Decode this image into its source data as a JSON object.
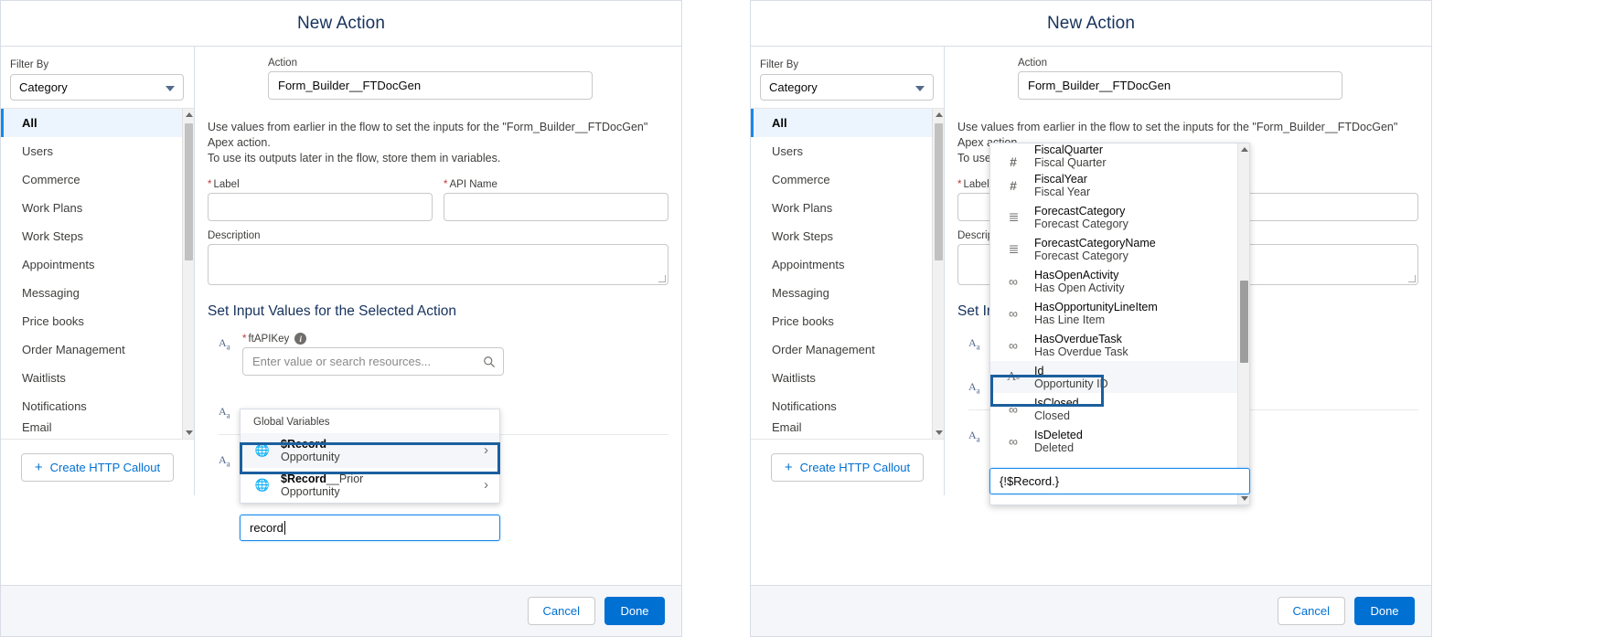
{
  "modal": {
    "title": "New Action"
  },
  "sidebar": {
    "filter_label": "Filter By",
    "filter_value": "Category",
    "items": [
      {
        "label": "All",
        "selected": true
      },
      {
        "label": "Users",
        "selected": false
      },
      {
        "label": "Commerce",
        "selected": false
      },
      {
        "label": "Work Plans",
        "selected": false
      },
      {
        "label": "Work Steps",
        "selected": false
      },
      {
        "label": "Appointments",
        "selected": false
      },
      {
        "label": "Messaging",
        "selected": false
      },
      {
        "label": "Price books",
        "selected": false
      },
      {
        "label": "Order Management",
        "selected": false
      },
      {
        "label": "Waitlists",
        "selected": false
      },
      {
        "label": "Notifications",
        "selected": false
      },
      {
        "label": "Email",
        "selected": false
      }
    ],
    "callout_button": "Create HTTP Callout",
    "plus_icon": "+"
  },
  "content": {
    "action_label": "Action",
    "action_value": "Form_Builder__FTDocGen",
    "helper_line1": "Use values from earlier in the flow to set the inputs for the \"Form_Builder__FTDocGen\" Apex action.",
    "helper_line2": "To use its outputs later in the flow, store them in variables.",
    "label_label": "Label",
    "label_value": "",
    "api_name_label": "API Name",
    "api_name_value": "",
    "description_label": "Description",
    "description_value": "",
    "section_title": "Set Input Values for the Selected Action",
    "ftapikey_label": "ftAPIKey",
    "ftapikey_info": "i",
    "ftapikey_placeholder": "Enter value or search resources...",
    "required_marker": "*",
    "text_type_icon": "Aa"
  },
  "left_popup": {
    "group_label": "Global Variables",
    "options": [
      {
        "name": "$Record",
        "sub": "Opportunity",
        "icon": "globe-icon",
        "chevron": "›",
        "highlighted": true
      },
      {
        "name": "$Record__Prior",
        "name_bold": "$Record",
        "name_rest": "__Prior",
        "sub": "Opportunity",
        "icon": "globe-icon",
        "chevron": "›",
        "highlighted": false
      }
    ],
    "typed_value": "record"
  },
  "right_popup": {
    "options": [
      {
        "api": "FiscalQuarter",
        "label": "Fiscal Quarter",
        "icon": "number-icon",
        "glyph": "#",
        "highlighted": false
      },
      {
        "api": "FiscalYear",
        "label": "Fiscal Year",
        "icon": "number-icon",
        "glyph": "#",
        "highlighted": false
      },
      {
        "api": "ForecastCategory",
        "label": "Forecast Category",
        "icon": "picklist-icon",
        "glyph": "☰",
        "highlighted": false
      },
      {
        "api": "ForecastCategoryName",
        "label": "Forecast Category",
        "icon": "picklist-icon",
        "glyph": "☰",
        "highlighted": false
      },
      {
        "api": "HasOpenActivity",
        "label": "Has Open Activity",
        "icon": "boolean-icon",
        "glyph": "∞",
        "highlighted": false
      },
      {
        "api": "HasOpportunityLineItem",
        "label": "Has Line Item",
        "icon": "boolean-icon",
        "glyph": "∞",
        "highlighted": false
      },
      {
        "api": "HasOverdueTask",
        "label": "Has Overdue Task",
        "icon": "boolean-icon",
        "glyph": "∞",
        "highlighted": false
      },
      {
        "api": "Id",
        "label": "Opportunity ID",
        "icon": "text-icon",
        "glyph": "Aa",
        "highlighted": true
      },
      {
        "api": "IsClosed",
        "label": "Closed",
        "icon": "boolean-icon",
        "glyph": "∞",
        "highlighted": false
      },
      {
        "api": "IsDeleted",
        "label": "Deleted",
        "icon": "boolean-icon",
        "glyph": "∞",
        "highlighted": false
      }
    ],
    "typed_value": "{!$Record.}"
  },
  "footer": {
    "cancel": "Cancel",
    "done": "Done"
  },
  "colors": {
    "brand_blue": "#0070d2",
    "link_blue": "#0070d2",
    "highlight_border": "#1b5f9e",
    "selected_bg": "#ecf5fd",
    "required_red": "#c23934",
    "footer_bg": "#f4f6f9"
  }
}
